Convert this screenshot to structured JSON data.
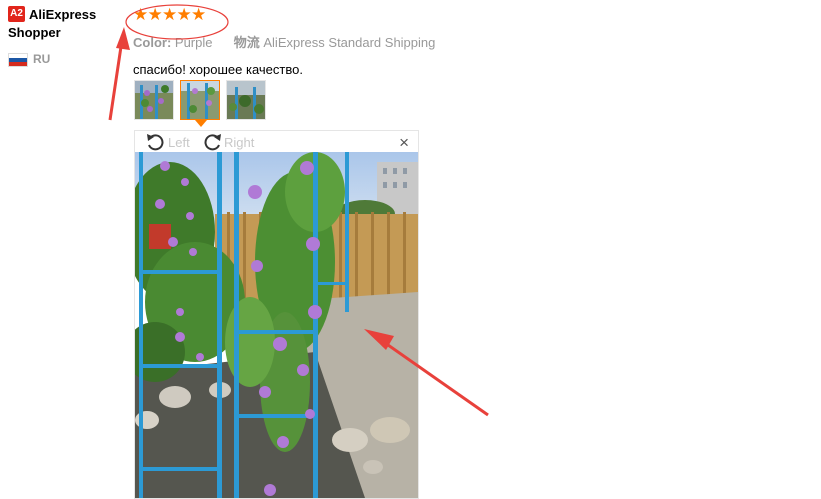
{
  "user": {
    "badge": "A2",
    "name": "AliExpress Shopper",
    "country": "RU"
  },
  "review": {
    "stars": [
      "★",
      "★",
      "★",
      "★",
      "★"
    ],
    "color_label": "Color:",
    "color_value": "Purple",
    "shipping_label": "物流",
    "shipping_value": "AliExpress Standard Shipping",
    "text": "спасибо! хорошее качество."
  },
  "viewer": {
    "rotate_left": "Left",
    "rotate_right": "Right",
    "close": "×"
  },
  "colors": {
    "star": "#ff7e00",
    "badge": "#e1251b",
    "annotation": "#e8413b"
  }
}
